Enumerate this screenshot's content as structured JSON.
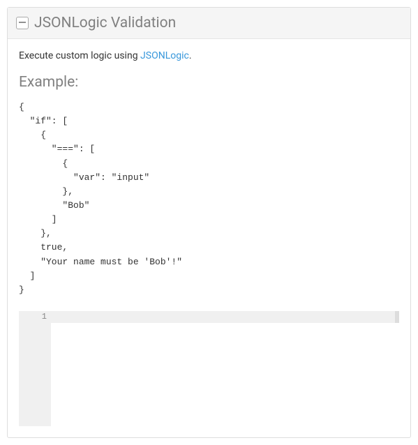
{
  "panel": {
    "title": "JSONLogic Validation",
    "collapse_symbol": "－"
  },
  "description": {
    "prefix": "Execute custom logic using ",
    "link_text": "JSONLogic",
    "suffix": "."
  },
  "example": {
    "heading": "Example:",
    "code": "{\n  \"if\": [\n    {\n      \"===\": [\n        {\n          \"var\": \"input\"\n        },\n        \"Bob\"\n      ]\n    },\n    true,\n    \"Your name must be 'Bob'!\"\n  ]\n}"
  },
  "editor": {
    "line_number": "1",
    "content": ""
  }
}
